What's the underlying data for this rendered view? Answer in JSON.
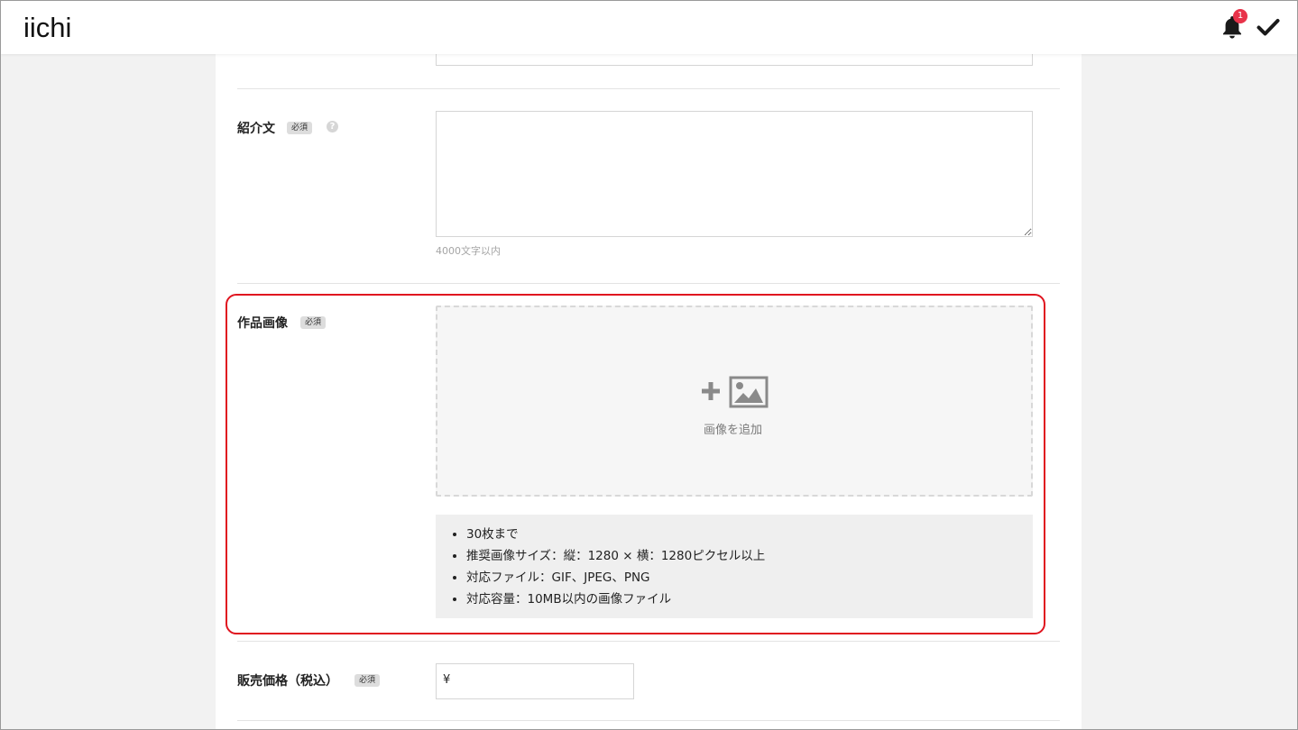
{
  "header": {
    "logo": "iichi",
    "notification_count": "1"
  },
  "description_field": {
    "label": "紹介文",
    "required_badge": "必須",
    "help_glyph": "?",
    "char_limit_hint": "4000文字以内"
  },
  "images_field": {
    "label": "作品画像",
    "required_badge": "必須",
    "add_label": "画像を追加",
    "rules": [
      "30枚まで",
      "推奨画像サイズ：縦：1280 × 横：1280ピクセル以上",
      "対応ファイル：GIF、JPEG、PNG",
      "対応容量：10MB以内の画像ファイル"
    ]
  },
  "price_field": {
    "label": "販売価格（税込）",
    "required_badge": "必須",
    "currency_prefix": "¥"
  },
  "colors": {
    "highlight": "#e0141f",
    "badge": "#e8334a",
    "icon_gray": "#8a8a8a"
  },
  "icons": [
    "bell-icon",
    "check-icon",
    "help-icon",
    "plus-icon",
    "image-icon"
  ]
}
